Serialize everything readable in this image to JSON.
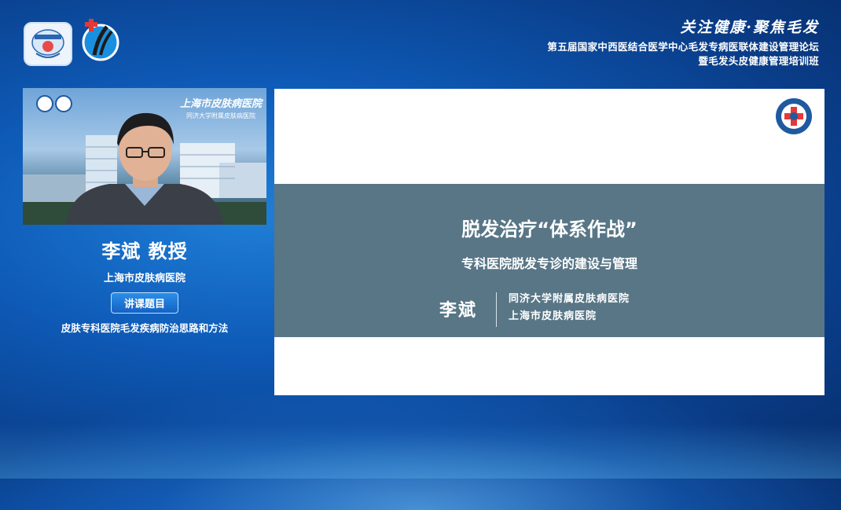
{
  "header": {
    "slogan": "关注健康·聚焦毛发",
    "forum_line1": "第五届国家中西医结合医学中心毛发专病医联体建设管理论坛",
    "forum_line2": "暨毛发头皮健康管理培训班"
  },
  "video": {
    "hospital_sign": "上海市皮肤病医院",
    "hospital_sign_sub": "同济大学附属皮肤病医院"
  },
  "speaker": {
    "name": "李斌 教授",
    "hospital": "上海市皮肤病医院",
    "topic_label": "讲课题目",
    "topic": "皮肤专科医院毛发疾病防治思路和方法"
  },
  "slide": {
    "title": "脱发治疗“体系作战”",
    "subtitle": "专科医院脱发专诊的建设与管理",
    "author": "李斌",
    "affiliation1": "同济大学附属皮肤病医院",
    "affiliation2": "上海市皮肤病医院"
  },
  "colors": {
    "background": "#0e5bb8",
    "slide_band": "#587686",
    "topic_badge": "#1462c4"
  }
}
